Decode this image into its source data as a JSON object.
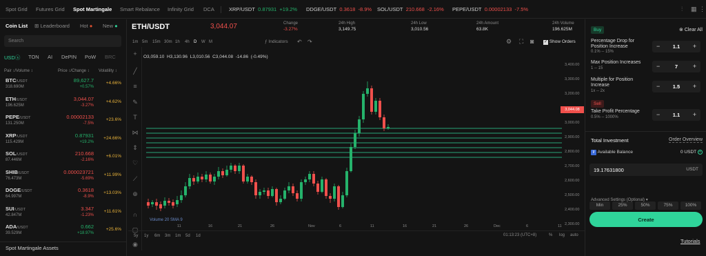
{
  "topnav": {
    "tabs": [
      "Spot Grid",
      "Futures Grid",
      "Spot Martingale",
      "Smart Rebalance",
      "Infinity Grid",
      "DCA"
    ],
    "active": "Spot Martingale",
    "tickers": [
      {
        "pair": "XRP/USDT",
        "price": "0.87931",
        "change": "+19.2%",
        "dir": "up"
      },
      {
        "pair": "DDGE/USDT",
        "price": "0.3618",
        "change": "-8.9%",
        "dir": "down"
      },
      {
        "pair": "SOL/USDT",
        "price": "210.668",
        "change": "-2.16%",
        "dir": "down"
      },
      {
        "pair": "PEPE/USDT",
        "price": "0.00002133",
        "change": "-7.5%",
        "dir": "down"
      }
    ]
  },
  "left": {
    "tabs": {
      "coin_list": "Coin List",
      "leaderboard": "Leaderboard",
      "hot": "Hot",
      "new": "New"
    },
    "search_placeholder": "Search",
    "chips": [
      "USDⓢ",
      "TON",
      "AI",
      "DePIN",
      "PoW",
      "BRC"
    ],
    "headers": {
      "pair": "Pair ↕/Volume ↕",
      "price": "Price ↕/Change ↕",
      "volatility": "Volatility ↕"
    },
    "rows": [
      {
        "sym": "BTC",
        "quote": "/USDT",
        "vol": "318.690M",
        "price": "89,627.7",
        "chg": "+0.57%",
        "vola": "+4.66%",
        "dir": "up"
      },
      {
        "sym": "ETH",
        "quote": "/USDT",
        "vol": "196.625M",
        "price": "3,044.07",
        "chg": "-3.27%",
        "vola": "+4.62%",
        "dir": "down"
      },
      {
        "sym": "PEPE",
        "quote": "/USDT",
        "vol": "131.250M",
        "price": "0.00002133",
        "chg": "-7.5%",
        "vola": "+23.6%",
        "dir": "down"
      },
      {
        "sym": "XRP",
        "quote": "/USDT",
        "vol": "115.429M",
        "price": "0.87931",
        "chg": "+19.2%",
        "vola": "+24.66%",
        "dir": "up"
      },
      {
        "sym": "SOL",
        "quote": "/USDT",
        "vol": "87.446M",
        "price": "210.668",
        "chg": "-2.16%",
        "vola": "+6.01%",
        "dir": "down"
      },
      {
        "sym": "SHIB",
        "quote": "/USDT",
        "vol": "76.473M",
        "price": "0.000023721",
        "chg": "-5.69%",
        "vola": "+11.99%",
        "dir": "down"
      },
      {
        "sym": "DOGE",
        "quote": "/USDT",
        "vol": "64.997M",
        "price": "0.3618",
        "chg": "-8.9%",
        "vola": "+13.03%",
        "dir": "down"
      },
      {
        "sym": "SUI",
        "quote": "/USDT",
        "vol": "42.847M",
        "price": "3.347",
        "chg": "-1.23%",
        "vola": "+11.61%",
        "dir": "down"
      },
      {
        "sym": "ADA",
        "quote": "/USDT",
        "vol": "39.529M",
        "price": "0.662",
        "chg": "+18.97%",
        "vola": "+25.6%",
        "dir": "up"
      }
    ],
    "footer": "Spot Martingale Assets"
  },
  "chart": {
    "pair": "ETH/USDT",
    "price": "3,044.07",
    "stats": [
      {
        "label": "Change",
        "value": "-3.27%",
        "color": "r"
      },
      {
        "label": "24h High",
        "value": "3,149.75",
        "color": ""
      },
      {
        "label": "24h Low",
        "value": "3,010.56",
        "color": ""
      },
      {
        "label": "24h Amount",
        "value": "63.8K",
        "color": ""
      },
      {
        "label": "24h Volume",
        "value": "196.625M",
        "color": ""
      }
    ],
    "timeframes": [
      "1m",
      "5m",
      "15m",
      "30m",
      "1h",
      "4h",
      "D",
      "W",
      "M"
    ],
    "indicators": "Indicators",
    "show_orders": "Show Orders",
    "ohlc": "O3,059.10  H3,130.96  L3,010.56  C3,044.08  -14.86  (-0.49%)",
    "yticks": [
      "3,400.00",
      "3,300.00",
      "3,200.00",
      "3,100.00",
      "3,000.00",
      "2,900.00",
      "2,800.00",
      "2,700.00",
      "2,600.00",
      "2,500.00",
      "2,400.00",
      "2,300.00"
    ],
    "price_tag": "3,044.08",
    "xticks": [
      "11",
      "16",
      "21",
      "26",
      "Nov",
      "6",
      "11",
      "16",
      "21",
      "26",
      "Dec",
      "6",
      "11"
    ],
    "volume_label": "Volume 20 SMA 9",
    "ranges": [
      "5y",
      "1y",
      "6m",
      "3m",
      "1m",
      "5d",
      "1d"
    ],
    "time": "01:13:23 (UTC+8)",
    "scale_opts": [
      "%",
      "log",
      "auto"
    ]
  },
  "right": {
    "buy": "Buy",
    "clear_all": "Clear All",
    "sell": "Sell",
    "params": [
      {
        "label": "Percentage Drop for Position Increase",
        "range": "0.1% -- 15%",
        "value": "1.1"
      },
      {
        "label": "Max Position Increases",
        "range": "1 -- 15",
        "value": "7"
      },
      {
        "label": "Multiple for Position Increase",
        "range": "1x -- 2x",
        "value": "1.5"
      },
      {
        "label": "Take Profit Percentage",
        "range": "0.5% -- 1000%",
        "value": "1.1"
      }
    ],
    "total_investment": "Total Investment",
    "order_overview": "Order Overview",
    "available_label": "Available Balance",
    "available_value": "0 USDT",
    "amount": "19.17631800",
    "amount_unit": "USDT",
    "pcts": [
      "Min",
      "25%",
      "50%",
      "75%",
      "100%"
    ],
    "advanced": "Advanced Settings (Optional)",
    "create": "Create",
    "tutorials": "Tutorials",
    "colors": {
      "green": "#25b26b",
      "red": "#f0504c",
      "accent": "#2fd49a"
    }
  }
}
